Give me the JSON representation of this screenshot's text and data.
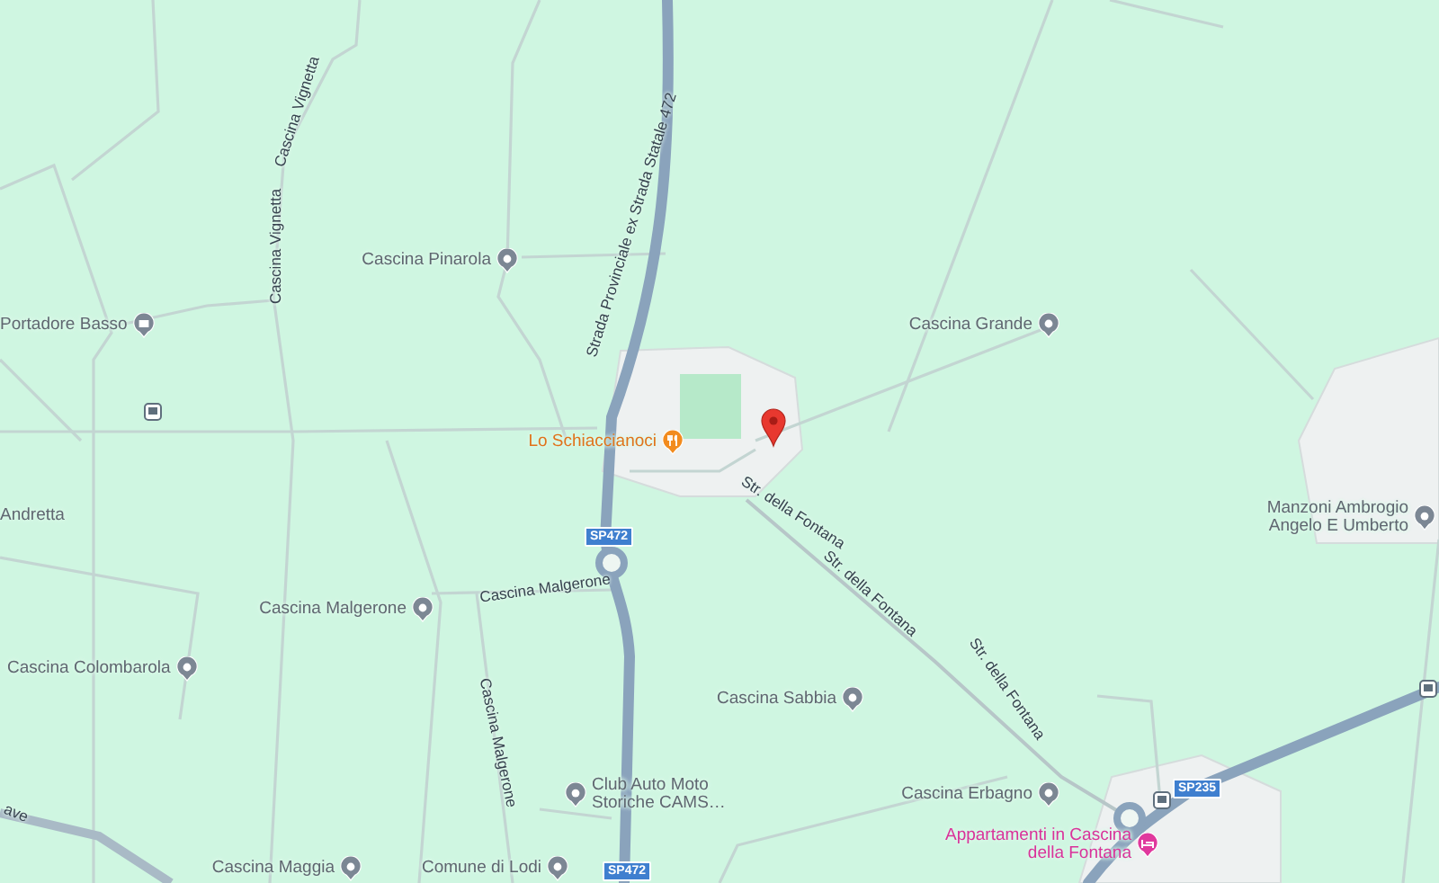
{
  "map": {
    "road_labels": [
      {
        "text": "Cascina Vignetta"
      },
      {
        "text": "Cascina Vignetta"
      },
      {
        "text": "Strada Provinciale ex Strada Statale 472"
      },
      {
        "text": "Cascina Malgerone"
      },
      {
        "text": "Cascina Malgerone"
      },
      {
        "text": "Str. della Fontana"
      },
      {
        "text": "Str. della Fontana"
      },
      {
        "text": "Str. della Fontana"
      },
      {
        "text": "ave"
      }
    ],
    "road_shields": [
      {
        "text": "SP472"
      },
      {
        "text": "SP472"
      },
      {
        "text": "SP235"
      }
    ],
    "places": [
      {
        "name": "Cascina Pinarola",
        "kind": "landmark"
      },
      {
        "name": "Portadore Basso",
        "kind": "shop"
      },
      {
        "name": "Lo Schiaccianoci",
        "kind": "restaurant"
      },
      {
        "name": "Cascina Grande",
        "kind": "landmark"
      },
      {
        "name": "Andretta",
        "kind": "area"
      },
      {
        "name": "Manzoni Ambrogio Angelo E Umberto",
        "kind": "landmark"
      },
      {
        "name": "Cascina Malgerone",
        "kind": "landmark"
      },
      {
        "name": "Cascina Colombarola",
        "kind": "landmark"
      },
      {
        "name": "Club Auto Moto Storiche CAMS…",
        "kind": "landmark"
      },
      {
        "name": "Cascina Sabbia",
        "kind": "landmark"
      },
      {
        "name": "Cascina Erbagno",
        "kind": "landmark"
      },
      {
        "name": "Appartamenti in Cascina della Fontana",
        "kind": "hotel"
      },
      {
        "name": "Cascina Maggia",
        "kind": "landmark"
      },
      {
        "name": "Comune di Lodi",
        "kind": "landmark"
      }
    ]
  }
}
